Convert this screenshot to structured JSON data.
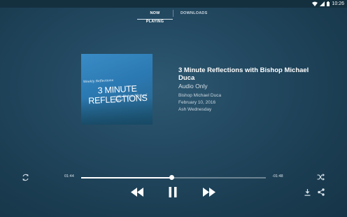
{
  "status": {
    "time": "10:26"
  },
  "tabs": [
    {
      "label": "NOW PLAYING",
      "active": true
    },
    {
      "label": "DOWNLOADS",
      "active": false
    }
  ],
  "artwork": {
    "small_text": "Weekly Reflections",
    "title": "3 MINUTE REFLECTIONS",
    "subtitle": "with Bishop Michael Duca"
  },
  "episode": {
    "title": "3 Minute Reflections with Bishop Michael Duca",
    "media_type": "Audio Only",
    "author": "Bishop Michael Duca",
    "date": "February 10, 2016",
    "occasion": "Ash Wednesday"
  },
  "player": {
    "elapsed": "01:44",
    "remaining": "-01:48",
    "progress": 0.49,
    "icons": [
      "repeat-icon",
      "rewind-icon",
      "pause-icon",
      "fast-forward-icon",
      "shuffle-icon",
      "download-icon",
      "share-icon"
    ]
  },
  "colors": {
    "background": "#234a62",
    "statusbar": "#14303f",
    "accent": "#ffffff"
  }
}
